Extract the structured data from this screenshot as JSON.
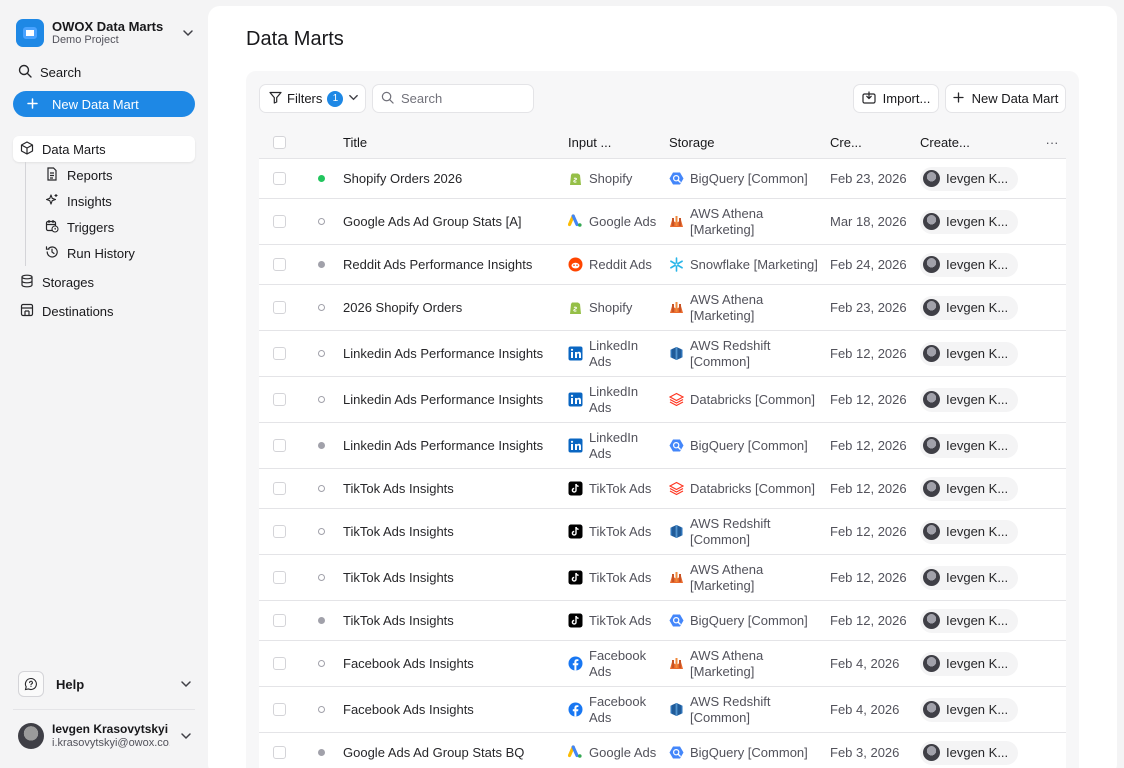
{
  "project": {
    "name": "OWOX Data Marts",
    "subtitle": "Demo Project"
  },
  "sidebar": {
    "search_label": "Search",
    "new_button_label": "New Data Mart",
    "items": [
      {
        "label": "Data Marts",
        "icon": "cube-icon",
        "active": true
      },
      {
        "label": "Reports",
        "icon": "document-icon",
        "sub": true
      },
      {
        "label": "Insights",
        "icon": "sparkles-icon",
        "sub": true
      },
      {
        "label": "Triggers",
        "icon": "calendar-clock-icon",
        "sub": true
      },
      {
        "label": "Run History",
        "icon": "history-icon",
        "sub": true
      },
      {
        "label": "Storages",
        "icon": "database-icon"
      },
      {
        "label": "Destinations",
        "icon": "destination-icon"
      }
    ],
    "help_label": "Help",
    "user": {
      "name": "Ievgen Krasovytskyi",
      "email": "i.krasovytskyi@owox.co..."
    }
  },
  "main": {
    "title": "Data Marts",
    "toolbar": {
      "filters_label": "Filters",
      "filters_count": "1",
      "search_placeholder": "Search",
      "import_label": "Import...",
      "new_label": "New Data Mart"
    },
    "table": {
      "columns": {
        "title": "Title",
        "input": "Input ...",
        "storage": "Storage",
        "created": "Cre...",
        "creator": "Create...",
        "more": "···"
      },
      "rows": [
        {
          "status": "green",
          "title": "Shopify Orders 2026",
          "input": "Shopify",
          "input_icon": "shopify",
          "storage": "BigQuery [Common]",
          "storage_icon": "bigquery",
          "created": "Feb 23, 2026",
          "creator": "Ievgen K...",
          "h": 40
        },
        {
          "status": "hollow",
          "title": "Google Ads Ad Group Stats [A]",
          "input": "Google Ads",
          "input_icon": "googleads",
          "storage": "AWS Athena [Marketing]",
          "storage_icon": "athena",
          "created": "Mar 18, 2026",
          "creator": "Ievgen K...",
          "h": 46
        },
        {
          "status": "gray",
          "title": "Reddit Ads Performance Insights",
          "input": "Reddit Ads",
          "input_icon": "reddit",
          "storage": "Snowflake [Marketing]",
          "storage_icon": "snowflake",
          "created": "Feb 24, 2026",
          "creator": "Ievgen K...",
          "h": 40
        },
        {
          "status": "hollow",
          "title": "2026 Shopify Orders",
          "input": "Shopify",
          "input_icon": "shopify",
          "storage": "AWS Athena [Marketing]",
          "storage_icon": "athena",
          "created": "Feb 23, 2026",
          "creator": "Ievgen K...",
          "h": 46
        },
        {
          "status": "hollow",
          "title": "Linkedin Ads Performance Insights",
          "input": "LinkedIn Ads",
          "input_icon": "linkedin",
          "storage": "AWS Redshift [Common]",
          "storage_icon": "redshift",
          "created": "Feb 12, 2026",
          "creator": "Ievgen K...",
          "h": 46
        },
        {
          "status": "hollow",
          "title": "Linkedin Ads Performance Insights",
          "input": "LinkedIn Ads",
          "input_icon": "linkedin",
          "storage": "Databricks [Common]",
          "storage_icon": "databricks",
          "created": "Feb 12, 2026",
          "creator": "Ievgen K...",
          "h": 46
        },
        {
          "status": "gray",
          "title": "Linkedin Ads Performance Insights",
          "input": "LinkedIn Ads",
          "input_icon": "linkedin",
          "storage": "BigQuery [Common]",
          "storage_icon": "bigquery",
          "created": "Feb 12, 2026",
          "creator": "Ievgen K...",
          "h": 46
        },
        {
          "status": "hollow",
          "title": "TikTok Ads Insights",
          "input": "TikTok Ads",
          "input_icon": "tiktok",
          "storage": "Databricks [Common]",
          "storage_icon": "databricks",
          "created": "Feb 12, 2026",
          "creator": "Ievgen K...",
          "h": 40
        },
        {
          "status": "hollow",
          "title": "TikTok Ads Insights",
          "input": "TikTok Ads",
          "input_icon": "tiktok",
          "storage": "AWS Redshift [Common]",
          "storage_icon": "redshift",
          "created": "Feb 12, 2026",
          "creator": "Ievgen K...",
          "h": 46
        },
        {
          "status": "hollow",
          "title": "TikTok Ads Insights",
          "input": "TikTok Ads",
          "input_icon": "tiktok",
          "storage": "AWS Athena [Marketing]",
          "storage_icon": "athena",
          "created": "Feb 12, 2026",
          "creator": "Ievgen K...",
          "h": 46
        },
        {
          "status": "gray",
          "title": "TikTok Ads Insights",
          "input": "TikTok Ads",
          "input_icon": "tiktok",
          "storage": "BigQuery [Common]",
          "storage_icon": "bigquery",
          "created": "Feb 12, 2026",
          "creator": "Ievgen K...",
          "h": 40
        },
        {
          "status": "hollow",
          "title": "Facebook Ads Insights",
          "input": "Facebook Ads",
          "input_icon": "facebook",
          "storage": "AWS Athena [Marketing]",
          "storage_icon": "athena",
          "created": "Feb 4, 2026",
          "creator": "Ievgen K...",
          "h": 46
        },
        {
          "status": "hollow",
          "title": "Facebook Ads Insights",
          "input": "Facebook Ads",
          "input_icon": "facebook",
          "storage": "AWS Redshift [Common]",
          "storage_icon": "redshift",
          "created": "Feb 4, 2026",
          "creator": "Ievgen K...",
          "h": 46
        },
        {
          "status": "gray",
          "title": "Google Ads Ad Group Stats BQ",
          "input": "Google Ads",
          "input_icon": "googleads",
          "storage": "BigQuery [Common]",
          "storage_icon": "bigquery",
          "created": "Feb 3, 2026",
          "creator": "Ievgen K...",
          "h": 40
        }
      ]
    }
  },
  "colors": {
    "accent": "#1e88e5",
    "status_green": "#22c55e",
    "status_gray": "#a1a1aa"
  }
}
